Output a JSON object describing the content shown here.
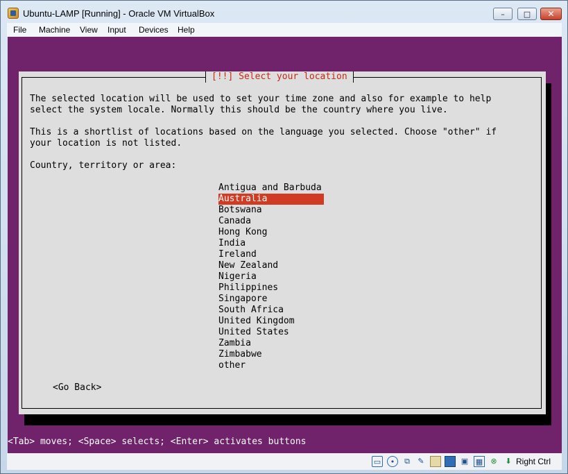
{
  "window": {
    "title": "Ubuntu-LAMP [Running] - Oracle VM VirtualBox",
    "minimize_glyph": "–",
    "maximize_glyph": "□",
    "close_glyph": "✕"
  },
  "menu": [
    "File",
    "Machine",
    "View",
    "Input",
    "Devices",
    "Help"
  ],
  "installer": {
    "title": "[!!] Select your location",
    "paragraph1": "The selected location will be used to set your time zone and also for example to help\nselect the system locale. Normally this should be the country where you live.",
    "paragraph2": "This is a shortlist of locations based on the language you selected. Choose \"other\" if\nyour location is not listed.",
    "prompt": "Country, territory or area:",
    "locations": [
      "Antigua and Barbuda",
      "Australia",
      "Botswana",
      "Canada",
      "Hong Kong",
      "India",
      "Ireland",
      "New Zealand",
      "Nigeria",
      "Philippines",
      "Singapore",
      "South Africa",
      "United Kingdom",
      "United States",
      "Zambia",
      "Zimbabwe",
      "other"
    ],
    "selected_location": "Australia",
    "go_back": "<Go Back>",
    "help_line": "<Tab> moves; <Space> selects; <Enter> activates buttons"
  },
  "status_bar": {
    "icons": [
      "hard-disk-icon",
      "optical-drive-icon",
      "usb-icon",
      "pen-icon",
      "shared-folders-icon",
      "display-icon",
      "video-capture-icon",
      "cpu-icon",
      "network-icon",
      "mouse-integration-icon"
    ],
    "host_key": "Right Ctrl"
  },
  "colors": {
    "desktop": "#70226a",
    "dialog": "#dedede",
    "highlight": "#d03b23",
    "title_text": "#c32a16"
  }
}
